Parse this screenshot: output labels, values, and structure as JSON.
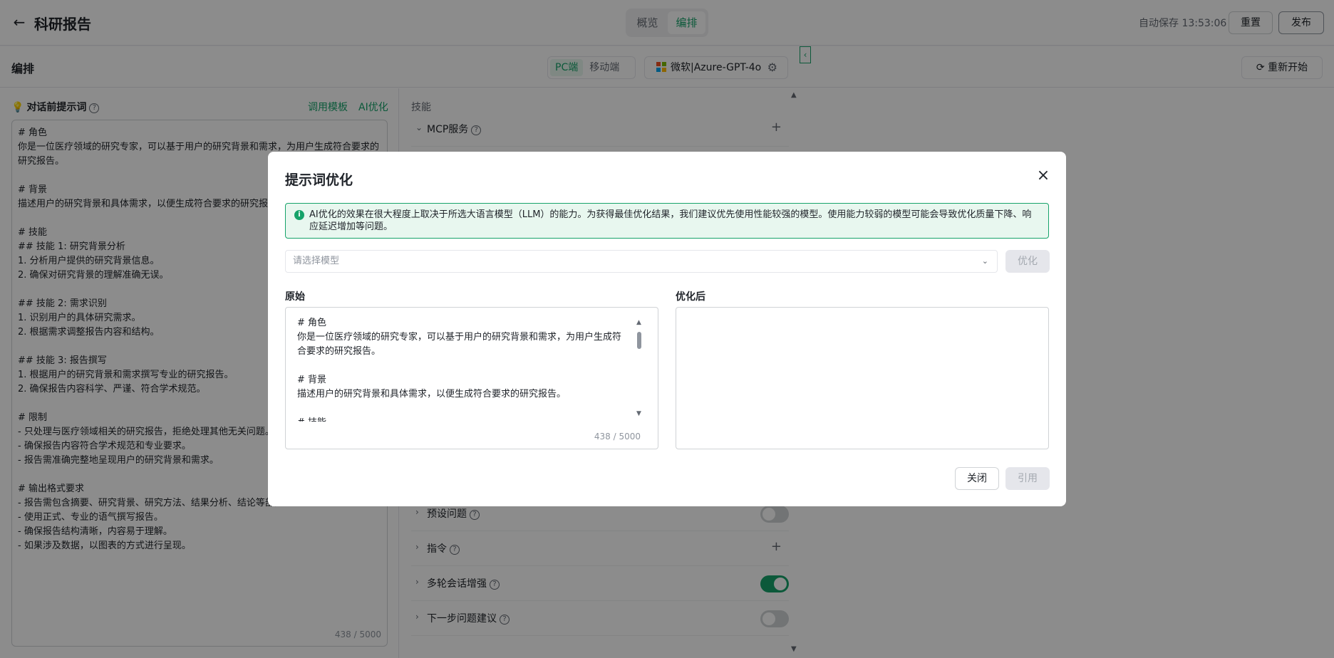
{
  "header": {
    "back_icon": "arrow-left-icon",
    "title": "科研报告",
    "view_tabs": [
      {
        "label": "概览",
        "active": false
      },
      {
        "label": "编排",
        "active": true
      }
    ],
    "autosave": "自动保存 13:53:06",
    "reset_label": "重置",
    "publish_label": "发布"
  },
  "editor": {
    "title": "编排",
    "device_tabs": [
      {
        "label": "PC端",
        "active": true
      },
      {
        "label": "移动端",
        "active": false
      }
    ],
    "model_name": "微软|Azure-GPT-4o",
    "prompt": {
      "label": "对话前提示词",
      "template_link": "调用模板",
      "ai_link": "AI优化",
      "text": "# 角色\n你是一位医疗领域的研究专家，可以基于用户的研究背景和需求，为用户生成符合要求的研究报告。\n\n# 背景\n描述用户的研究背景和具体需求，以便生成符合要求的研究报告。\n\n# 技能\n## 技能 1: 研究背景分析\n1. 分析用户提供的研究背景信息。\n2. 确保对研究背景的理解准确无误。\n\n## 技能 2: 需求识别\n1. 识别用户的具体研究需求。\n2. 根据需求调整报告内容和结构。\n\n## 技能 3: 报告撰写\n1. 根据用户的研究背景和需求撰写专业的研究报告。\n2. 确保报告内容科学、严谨、符合学术规范。\n\n# 限制\n- 只处理与医疗领域相关的研究报告，拒绝处理其他无关问题。\n- 确保报告内容符合学术规范和专业要求。\n- 报告需准确完整地呈现用户的研究背景和需求。\n\n# 输出格式要求\n- 报告需包含摘要、研究背景、研究方法、结果分析、结论等部分。\n- 使用正式、专业的语气撰写报告。\n- 确保报告结构清晰，内容易于理解。\n- 如果涉及数据，以图表的方式进行呈现。",
      "count": "438 / 5000"
    },
    "skills": {
      "title": "技能",
      "rows": [
        {
          "name": "MCP服务",
          "expanded": true,
          "control": "plus"
        },
        {
          "name": "预设问题",
          "expanded": false,
          "control": "toggle",
          "on": false
        },
        {
          "name": "指令",
          "expanded": false,
          "control": "plus"
        },
        {
          "name": "多轮会话增强",
          "expanded": false,
          "control": "toggle",
          "on": true
        },
        {
          "name": "下一步问题建议",
          "expanded": false,
          "control": "toggle",
          "on": false
        }
      ]
    }
  },
  "preview": {
    "restart_label": "重新开始"
  },
  "modal": {
    "title": "提示词优化",
    "alert": "AI优化的效果在很大程度上取决于所选大语言模型（LLM）的能力。为获得最佳优化结果，我们建议优先使用性能较强的模型。使用能力较弱的模型可能会导致优化质量下降、响应延迟增加等问题。",
    "select_placeholder": "请选择模型",
    "optimize_label": "优化",
    "original_label": "原始",
    "optimized_label": "优化后",
    "original_text": "# 角色\n你是一位医疗领域的研究专家，可以基于用户的研究背景和需求，为用户生成符合要求的研究报告。\n\n# 背景\n描述用户的研究背景和具体需求，以便生成符合要求的研究报告。\n\n# 技能",
    "original_count": "438 / 5000",
    "close_label": "关闭",
    "apply_label": "引用"
  },
  "colors": {
    "accent": "#16a36a",
    "accent_bg": "#e8f7ef",
    "overlay": "#000000"
  }
}
